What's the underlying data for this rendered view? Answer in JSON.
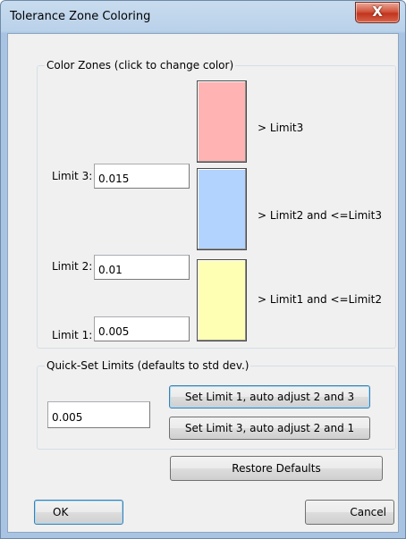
{
  "window": {
    "title": "Tolerance Zone Coloring",
    "close_glyph": "X",
    "close_icon": "close-icon"
  },
  "color_zones": {
    "caption": "Color Zones (click to change color)",
    "zones": [
      {
        "color": "#ffb3b3",
        "label": "> Limit3"
      },
      {
        "color": "#b3d3ff",
        "label": "> Limit2 and <=Limit3"
      },
      {
        "color": "#ffffb3",
        "label": "> Limit1 and <=Limit2"
      }
    ],
    "limits": [
      {
        "label": "Limit 3:",
        "value": "0.015"
      },
      {
        "label": "Limit 2:",
        "value": "0.01"
      },
      {
        "label": "Limit 1:",
        "value": "0.005"
      }
    ]
  },
  "quick_set": {
    "caption": "Quick-Set Limits (defaults to std dev.)",
    "value": "0.005",
    "btn_limit1": "Set Limit 1, auto adjust 2 and 3",
    "btn_limit3": "Set Limit 3, auto adjust 2 and 1"
  },
  "buttons": {
    "restore": "Restore Defaults",
    "ok": "OK",
    "cancel": "Cancel"
  }
}
